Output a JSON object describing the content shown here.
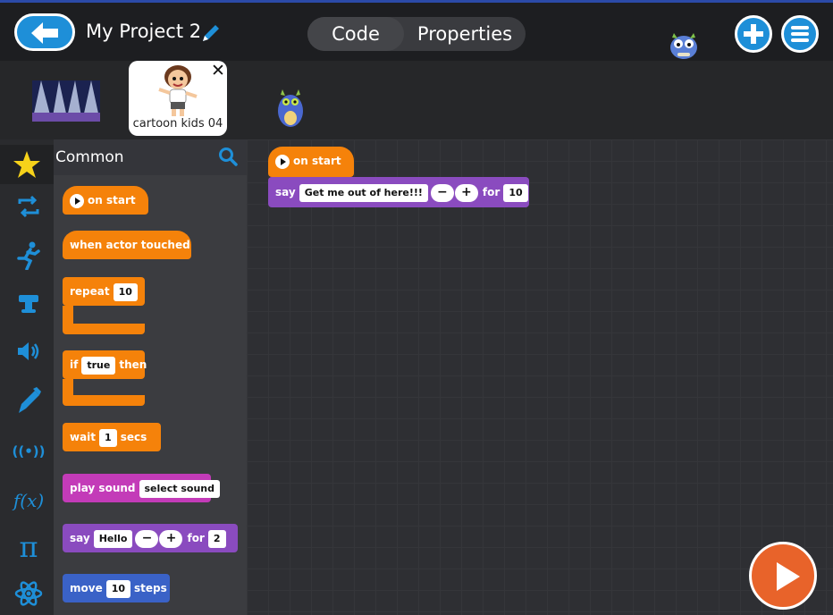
{
  "header": {
    "project_title": "My Project 2",
    "tabs": [
      {
        "label": "Code",
        "active": true
      },
      {
        "label": "Properties",
        "active": false
      }
    ]
  },
  "actors": {
    "selected_actor_name": "cartoon kids 04"
  },
  "palette": {
    "category_title": "Common",
    "rail_icons": [
      "star-icon",
      "loop-icon",
      "running-icon",
      "looks-icon",
      "sound-icon",
      "pen-icon",
      "broadcast-icon",
      "function-icon",
      "pi-icon",
      "atom-icon"
    ],
    "rail_texts": {
      "broadcast": "((•))",
      "function": "f(x)",
      "pi": "π"
    },
    "blocks": {
      "on_start": "on start",
      "when_touched": "when actor touched",
      "repeat_label": "repeat",
      "repeat_value": "10",
      "if_label": "if",
      "if_value": "true",
      "if_then": "then",
      "wait_label": "wait",
      "wait_value": "1",
      "wait_unit": "secs",
      "play_sound_label": "play sound",
      "play_sound_value": "select sound",
      "say_label": "say",
      "say_value": "Hello",
      "say_for": "for",
      "say_for_value": "2",
      "move_label": "move",
      "move_value": "10",
      "move_unit": "steps"
    }
  },
  "script": {
    "hat_label": "on start",
    "say_label": "say",
    "say_value": "Get me out of here!!!",
    "for_label": "for",
    "for_value": "10"
  },
  "symbols": {
    "minus": "−",
    "plus": "+",
    "close": "✕"
  },
  "colors": {
    "accent_blue": "#1e8fd8",
    "block_orange": "#f5820a",
    "block_magenta": "#c33bb8",
    "block_purple": "#8a4bbf",
    "block_blue": "#3a62c7",
    "run_button": "#e8632a"
  }
}
